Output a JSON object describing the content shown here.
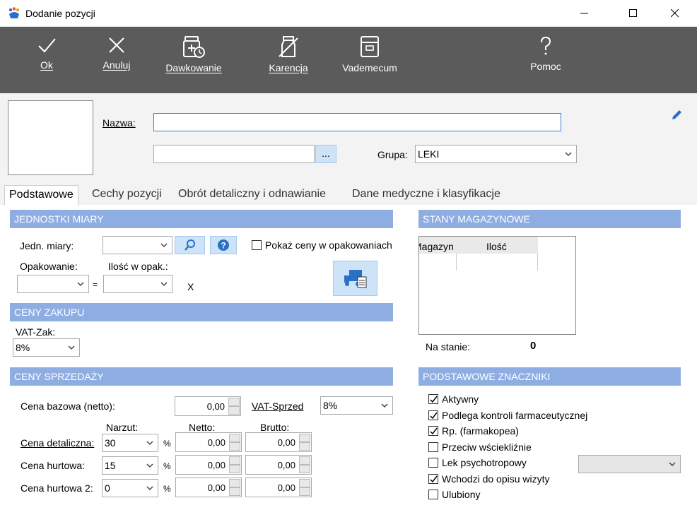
{
  "window": {
    "title": "Dodanie pozycji"
  },
  "toolbar": {
    "ok": "Ok",
    "cancel": "Anuluj",
    "dosage": "Dawkowanie",
    "withdrawal": "Karencja",
    "vademecum": "Vademecum",
    "help": "Pomoc"
  },
  "header": {
    "name_label": "Nazwa:",
    "name_value": "",
    "code_value": "",
    "browse_button": "...",
    "group_label": "Grupa:",
    "group_value": "LEKI"
  },
  "tabs": [
    {
      "label": "Podstawowe"
    },
    {
      "label": "Cechy pozycji"
    },
    {
      "label": "Obrót detaliczny i odnawianie"
    },
    {
      "label": "Dane medyczne i klasyfikacje"
    }
  ],
  "units": {
    "section": "JEDNOSTKI MIARY",
    "unit_label": "Jedn. miary:",
    "unit_value": "",
    "show_prices_label": "Pokaż ceny w opakowaniach",
    "package_label": "Opakowanie:",
    "qty_label": "Ilość w opak.:",
    "equals": "=",
    "x": "X"
  },
  "purchase": {
    "section": "CENY ZAKUPU",
    "vat_label": "VAT-Zak:",
    "vat_value": "8%"
  },
  "sales": {
    "section": "CENY SPRZEDAŻY",
    "base_price_label": "Cena bazowa (netto):",
    "base_price_value": "0,00",
    "vat_label": "VAT-Sprzed",
    "vat_value": "8%",
    "col_markup": "Narzut:",
    "col_net": "Netto:",
    "col_gross": "Brutto:",
    "percent": "%",
    "rows": [
      {
        "label": "Cena detaliczna:",
        "markup": "30",
        "net": "0,00",
        "gross": "0,00"
      },
      {
        "label": "Cena hurtowa:",
        "markup": "15",
        "net": "0,00",
        "gross": "0,00"
      },
      {
        "label": "Cena hurtowa 2:",
        "markup": "0",
        "net": "0,00",
        "gross": "0,00"
      }
    ]
  },
  "stock": {
    "section": "STANY MAGAZYNOWE",
    "col_warehouse": "Magazyn",
    "col_qty": "Ilość",
    "on_stock_label": "Na stanie:",
    "on_stock_value": "0"
  },
  "flags": {
    "section": "PODSTAWOWE ZNACZNIKI",
    "items": [
      {
        "label": "Aktywny",
        "checked": true
      },
      {
        "label": "Podlega kontroli farmaceutycznej",
        "checked": true
      },
      {
        "label": "Rp. (farmakopea)",
        "checked": true
      },
      {
        "label": "Przeciw wściekliźnie",
        "checked": false
      },
      {
        "label": "Lek psychotropowy",
        "checked": false
      },
      {
        "label": "Wchodzi do opisu wizyty",
        "checked": true
      },
      {
        "label": "Ulubiony",
        "checked": false
      }
    ]
  }
}
